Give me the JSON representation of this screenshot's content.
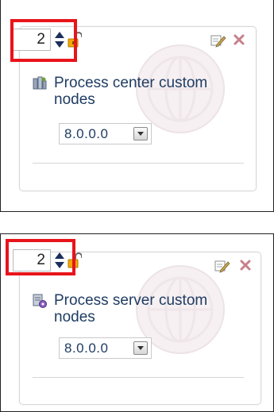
{
  "panels": [
    {
      "title": "Process center custom nodes",
      "version": "8.0.0.0",
      "count": "2",
      "node_icon": "process-center-nodes-icon"
    },
    {
      "title": "Process server custom nodes",
      "version": "8.0.0.0",
      "count": "2",
      "node_icon": "process-server-nodes-icon"
    }
  ],
  "colors": {
    "highlight": "#e8141b",
    "title_text": "#1f3c63",
    "close": "#c7808a",
    "lock": "#e8a100"
  }
}
